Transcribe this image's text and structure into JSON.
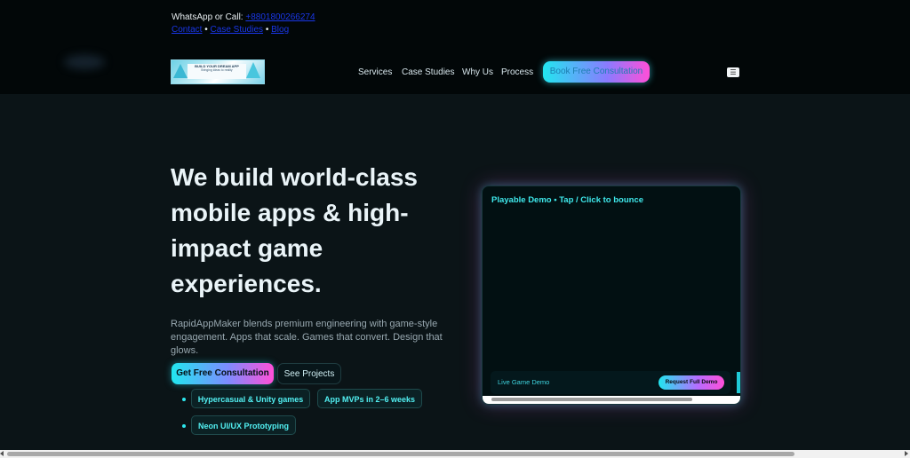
{
  "topbar": {
    "contact_prefix": "WhatsApp or Call: ",
    "phone": "+8801800266274",
    "links": [
      {
        "label": "Contact"
      },
      {
        "label": "Case Studies"
      },
      {
        "label": "Blog"
      }
    ],
    "separator": "•"
  },
  "header": {
    "logo": {
      "line1": "BUILD YOUR DREAM APP",
      "line2": "Bringing ideas to reality"
    },
    "nav": [
      {
        "label": "Services"
      },
      {
        "label": "Case Studies"
      },
      {
        "label": "Why Us"
      },
      {
        "label": "Process"
      }
    ],
    "cta_label": "Book Free Consultation",
    "menu_icon": "☰"
  },
  "hero": {
    "title": "We build world-class mobile apps & high-impact game experiences.",
    "description": "RapidAppMaker blends premium engineering with game-style engagement. Apps that scale. Games that convert. Design that glows.",
    "primary_button": "Get Free Consultation",
    "secondary_button": "See Projects",
    "features": [
      {
        "label": "Hypercasual & Unity games"
      },
      {
        "label": "App MVPs in 2–6 weeks"
      },
      {
        "label": "Neon UI/UX Prototyping"
      }
    ]
  },
  "demo": {
    "title": "Playable Demo • Tap / Click to bounce",
    "footer_label": "Live Game Demo",
    "footer_button": "Request Full Demo"
  },
  "colors": {
    "accent_cyan": "#22e6f0",
    "accent_pink": "#ff4fd8",
    "background": "#0b1417"
  }
}
